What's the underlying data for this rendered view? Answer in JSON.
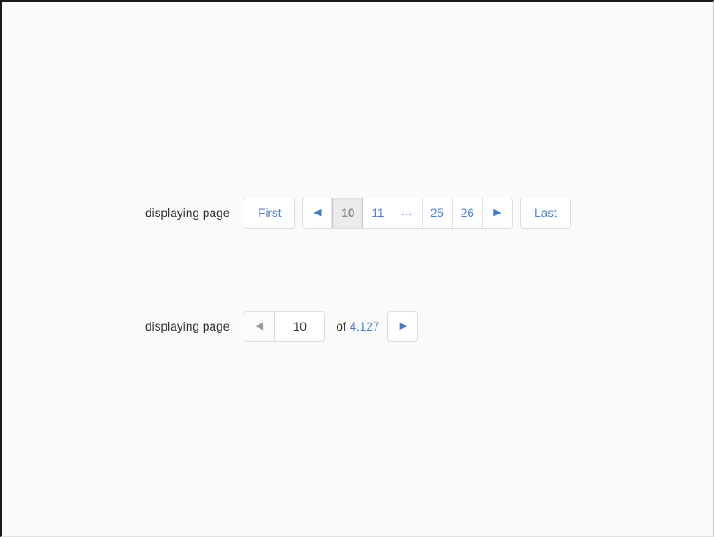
{
  "page": {
    "background_color": "#fafafa",
    "link_color": "#4a7ed4",
    "active_bg_color": "#ebebeb",
    "active_text_color": "#8a8a8a",
    "border_color": "#dcdcdc"
  },
  "pagers": [
    {
      "label": "displaying page",
      "first_label": "First",
      "last_label": "Last",
      "prev_icon": "◀",
      "next_icon": "▶",
      "pages": [
        {
          "label": "10",
          "active": true
        },
        {
          "label": "11",
          "active": false
        },
        {
          "label": "…",
          "active": false,
          "ellipsis": true
        },
        {
          "label": "25",
          "active": false
        },
        {
          "label": "26",
          "active": false
        }
      ]
    },
    {
      "label": "displaying page",
      "prev_icon": "◀",
      "next_icon": "▶",
      "current_page": "10",
      "current_page_placeholder": "page",
      "of_word": "of",
      "total_pages": "4,127"
    }
  ]
}
